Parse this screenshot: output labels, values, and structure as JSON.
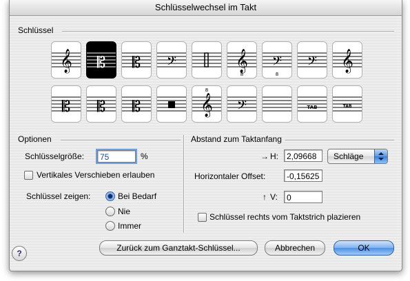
{
  "dialog": {
    "title": "Schlüsselwechsel im Takt"
  },
  "clef_group": {
    "label": "Schlüssel",
    "row1": [
      {
        "icon": "treble-clef-icon",
        "symbol": "𝄞",
        "selected": false
      },
      {
        "icon": "alto-clef-icon",
        "symbol": "𝄡",
        "selected": true
      },
      {
        "icon": "tenor-clef-icon",
        "symbol": "𝄡",
        "selected": false
      },
      {
        "icon": "bass-clef-icon",
        "symbol": "𝄢",
        "selected": false
      },
      {
        "icon": "percussion-clef-icon",
        "symbol": "",
        "selected": false
      },
      {
        "icon": "treble-8vb-clef-icon",
        "symbol": "𝄞",
        "selected": false
      },
      {
        "icon": "bass-8vb-clef-icon",
        "symbol": "𝄢",
        "selected": false
      },
      {
        "icon": "baritone-f-clef-icon",
        "symbol": "𝄢",
        "selected": false
      },
      {
        "icon": "french-violin-clef-icon",
        "symbol": "𝄞",
        "selected": false
      }
    ],
    "row2": [
      {
        "icon": "soprano-clef-icon",
        "symbol": "𝄡",
        "selected": false
      },
      {
        "icon": "mezzo-soprano-clef-icon",
        "symbol": "𝄡",
        "selected": false
      },
      {
        "icon": "baritone-c-clef-icon",
        "symbol": "𝄡",
        "selected": false
      },
      {
        "icon": "percussion-clef-2-icon",
        "symbol": "",
        "selected": false
      },
      {
        "icon": "treble-8va-clef-icon",
        "symbol": "𝄞",
        "selected": false
      },
      {
        "icon": "sub-bass-clef-icon",
        "symbol": "𝄢",
        "selected": false
      },
      {
        "icon": "blank-clef-icon",
        "symbol": "",
        "selected": false
      },
      {
        "icon": "tab-clef-icon",
        "symbol": "TAB",
        "selected": false
      },
      {
        "icon": "tab-small-clef-icon",
        "symbol": "TAB",
        "selected": false
      }
    ]
  },
  "options": {
    "label": "Optionen",
    "size_label": "Schlüsselgröße:",
    "size_value": "75",
    "size_unit": "%",
    "vertical_shift_label": "Vertikales Verschieben erlauben",
    "vertical_shift_checked": false,
    "show_label": "Schlüssel zeigen:",
    "show_options": [
      {
        "label": "Bei Bedarf",
        "selected": true
      },
      {
        "label": "Nie",
        "selected": false
      },
      {
        "label": "Immer",
        "selected": false
      }
    ]
  },
  "distance": {
    "label": "Abstand zum Taktanfang",
    "h_label": "H:",
    "h_value": "2,09668",
    "unit_value": "Schläge",
    "horizontal_offset_label": "Horizontaler Offset:",
    "horizontal_offset_value": "-0,15625",
    "v_label": "V:",
    "v_value": "0",
    "place_right_label": "Schlüssel rechts vom Taktstrich plazieren",
    "place_right_checked": false
  },
  "buttons": {
    "help": "?",
    "back": "Zurück zum Ganztakt-Schlüssel...",
    "cancel": "Abbrechen",
    "ok": "OK"
  },
  "colors": {
    "accent": "#4d8fe3",
    "focus": "#6f9fe0"
  }
}
